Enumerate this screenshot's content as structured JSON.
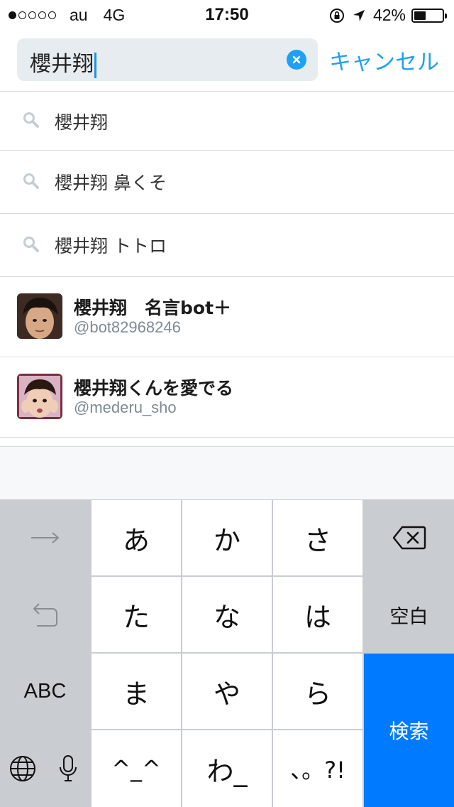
{
  "status_bar": {
    "carrier": "au",
    "network": "4G",
    "time": "17:50",
    "battery_percent": "42%",
    "battery_level": 0.42
  },
  "search": {
    "query": "櫻井翔",
    "cancel_label": "キャンセル"
  },
  "suggestions": [
    {
      "text": "櫻井翔"
    },
    {
      "text": "櫻井翔 鼻くそ"
    },
    {
      "text": "櫻井翔 トトロ"
    }
  ],
  "accounts": [
    {
      "name": "櫻井翔　名言bot＋",
      "handle": "@bot82968246"
    },
    {
      "name": "櫻井翔くんを愛でる",
      "handle": "@mederu_sho"
    }
  ],
  "keyboard": {
    "row1": [
      "あ",
      "か",
      "さ"
    ],
    "row2": [
      "た",
      "な",
      "は"
    ],
    "row3": [
      "ま",
      "や",
      "ら"
    ],
    "row4": [
      "^_^",
      "わ_",
      "、。?!"
    ],
    "space_label": "空白",
    "abc_label": "ABC",
    "search_label": "検索",
    "icons": [
      "next-arrow-icon",
      "undo-icon",
      "backspace-icon",
      "globe-icon",
      "microphone-icon"
    ]
  },
  "colors": {
    "accent": "#1da1f2",
    "search_key": "#007aff",
    "keyboard_bg": "#c9ccd1"
  }
}
